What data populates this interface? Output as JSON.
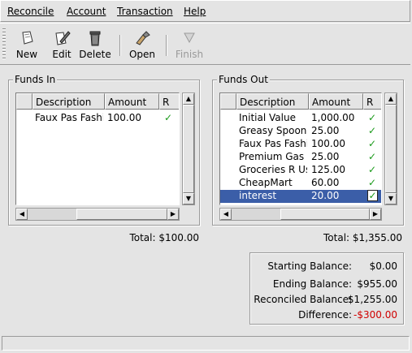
{
  "menu": {
    "reconcile": "Reconcile",
    "account": "Account",
    "transaction": "Transaction",
    "help": "Help"
  },
  "toolbar": {
    "new": "New",
    "edit": "Edit",
    "delete": "Delete",
    "open": "Open",
    "finish": "Finish"
  },
  "funds_in": {
    "title": "Funds In",
    "columns": {
      "description": "Description",
      "amount": "Amount",
      "reconciled": "R"
    },
    "rows": [
      {
        "description": "Faux Pas Fashions",
        "amount": "100.00",
        "reconciled": "✓"
      }
    ],
    "total_label": "Total:",
    "total": "$100.00"
  },
  "funds_out": {
    "title": "Funds Out",
    "columns": {
      "description": "Description",
      "amount": "Amount",
      "reconciled": "R"
    },
    "rows": [
      {
        "description": "Initial Value",
        "amount": "1,000.00",
        "reconciled": "✓"
      },
      {
        "description": "Greasy Spoon",
        "amount": "25.00",
        "reconciled": "✓"
      },
      {
        "description": "Faux Pas Fashions",
        "amount": "100.00",
        "reconciled": "✓"
      },
      {
        "description": "Premium Gas",
        "amount": "25.00",
        "reconciled": "✓"
      },
      {
        "description": "Groceries R Us",
        "amount": "125.00",
        "reconciled": "✓"
      },
      {
        "description": "CheapMart",
        "amount": "60.00",
        "reconciled": "✓"
      },
      {
        "description": "interest",
        "amount": "20.00",
        "reconciled": "✓"
      }
    ],
    "selected_row": "interest",
    "total_label": "Total:",
    "total": "$1,355.00"
  },
  "summary": {
    "starting_label": "Starting Balance:",
    "starting": "$0.00",
    "ending_label": "Ending Balance:",
    "ending": "$955.00",
    "reconciled_label": "Reconciled Balance:",
    "reconciled": "$1,255.00",
    "difference_label": "Difference:",
    "difference": "-$300.00"
  },
  "colors": {
    "selection": "#3b5ea8",
    "check": "#1a9a1a",
    "negative": "#d00000"
  },
  "icons": [
    "new-icon",
    "edit-icon",
    "delete-icon",
    "open-icon",
    "finish-icon"
  ]
}
